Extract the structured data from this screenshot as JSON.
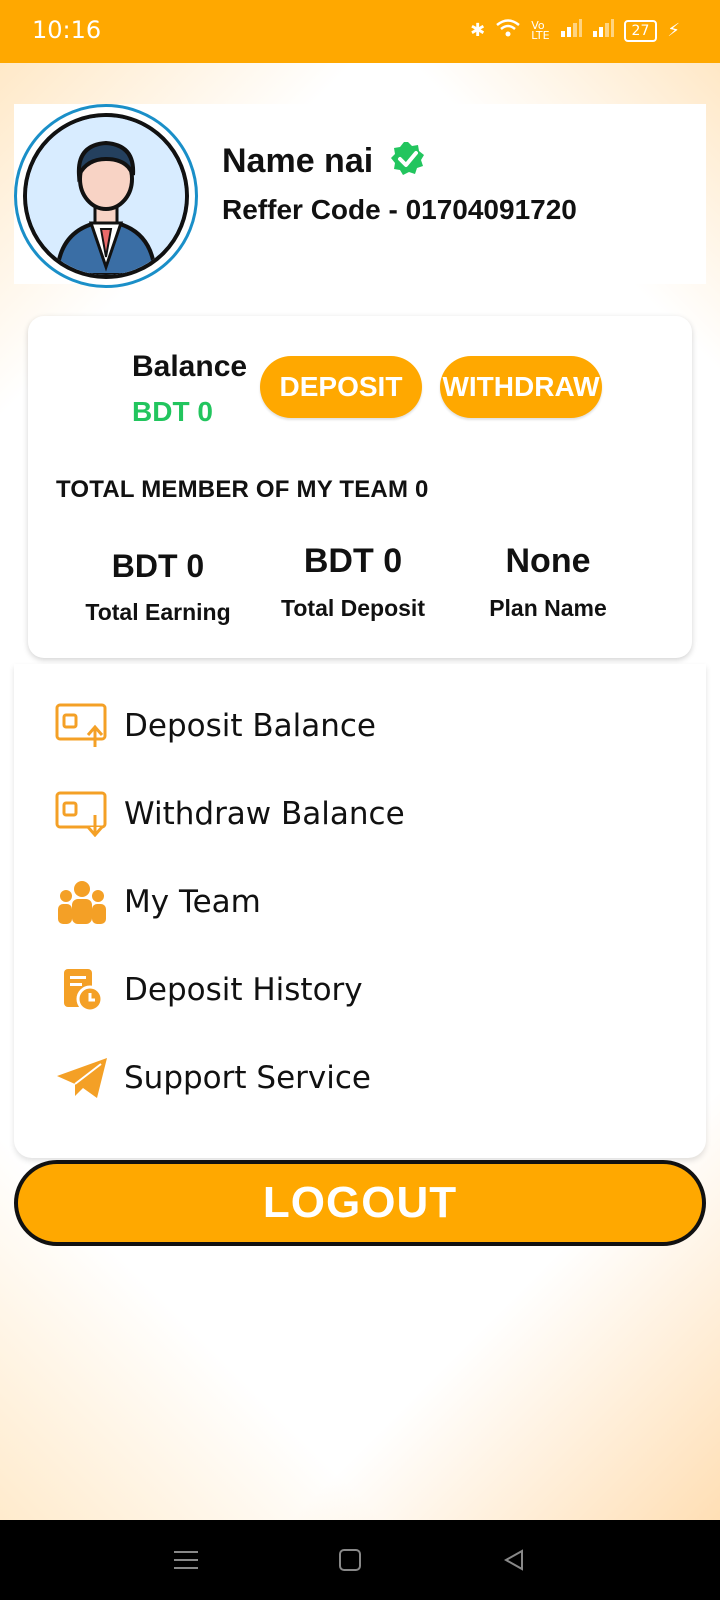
{
  "status_bar": {
    "time": "10:16",
    "battery": "27"
  },
  "profile": {
    "name": "Name nai",
    "reffer_code": "Reffer Code - 01704091720",
    "verified_color": "#22C55E"
  },
  "balance": {
    "label": "Balance",
    "value": "BDT 0",
    "deposit_button": "DEPOSIT",
    "withdraw_button": "WITHDRAW"
  },
  "team": {
    "total_text": "TOTAL MEMBER OF MY TEAM 0"
  },
  "stats": [
    {
      "value": "BDT 0",
      "label": "Total Earning"
    },
    {
      "value": "BDT 0",
      "label": "Total Deposit"
    },
    {
      "value": "None",
      "label": "Plan Name"
    }
  ],
  "menu": [
    {
      "label": "Deposit Balance",
      "icon": "deposit-balance-icon"
    },
    {
      "label": "Withdraw Balance",
      "icon": "withdraw-balance-icon"
    },
    {
      "label": "My Team",
      "icon": "team-icon"
    },
    {
      "label": "Deposit History",
      "icon": "history-icon"
    },
    {
      "label": "Support Service",
      "icon": "telegram-icon"
    }
  ],
  "logout": "LOGOUT",
  "colors": {
    "accent": "#FFA800",
    "success": "#22C55E",
    "text": "#111111"
  }
}
